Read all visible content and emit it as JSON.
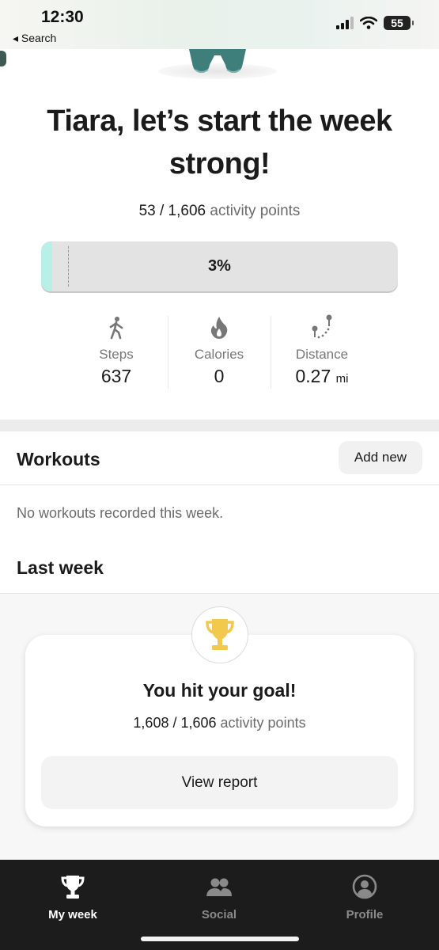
{
  "status_bar": {
    "time": "12:30",
    "back_label": "◂ Search",
    "battery": "55"
  },
  "hero": {
    "headline": "Tiara, let’s start the week strong!",
    "points_current": "53 / 1,606",
    "points_suffix": "activity points",
    "progress_label": "3%",
    "progress_fraction": 0.03
  },
  "stats": [
    {
      "icon": "walking-icon",
      "label": "Steps",
      "value": "637",
      "unit": ""
    },
    {
      "icon": "flame-icon",
      "label": "Calories",
      "value": "0",
      "unit": ""
    },
    {
      "icon": "distance-path-icon",
      "label": "Distance",
      "value": "0.27",
      "unit": "mi"
    }
  ],
  "workouts": {
    "title": "Workouts",
    "add_label": "Add new",
    "empty_text": "No workouts recorded this week."
  },
  "last_week": {
    "title": "Last week",
    "goal_title": "You hit your goal!",
    "goal_points": "1,608 / 1,606",
    "goal_suffix": "activity points",
    "report_label": "View report"
  },
  "tabs": [
    {
      "icon": "trophy-icon",
      "label": "My week",
      "active": true
    },
    {
      "icon": "people-icon",
      "label": "Social",
      "active": false
    },
    {
      "icon": "profile-icon",
      "label": "Profile",
      "active": false
    }
  ],
  "colors": {
    "progress_fill": "#b8efe6",
    "trophy": "#f2c94c",
    "tab_bar": "#1c1c1c"
  }
}
